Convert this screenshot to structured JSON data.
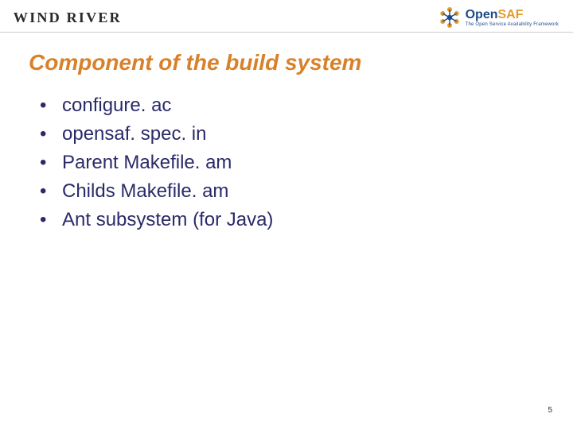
{
  "header": {
    "left_brand": "WIND RIVER",
    "right_brand_main_pre": "Open",
    "right_brand_main_accent": "SAF",
    "right_brand_tagline": "The Open Service Availability Framework"
  },
  "title": "Component of the build system",
  "bullets": [
    "configure. ac",
    "opensaf. spec. in",
    "Parent Makefile. am",
    "Childs Makefile. am",
    "Ant subsystem (for Java)"
  ],
  "page_number": "5"
}
